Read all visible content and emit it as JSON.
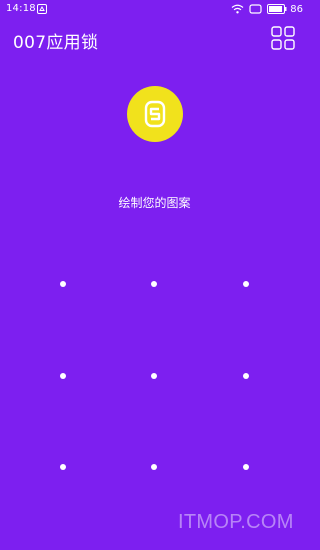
{
  "status_bar": {
    "time": "14:18",
    "battery_level": "86",
    "icons": [
      "notification-app-icon",
      "wifi-icon",
      "message-icon",
      "battery-icon"
    ]
  },
  "header": {
    "title": "007应用锁",
    "menu_icon": "grid-menu-icon"
  },
  "logo": {
    "icon": "lock-logo-icon",
    "accent_color": "#f1e21c"
  },
  "instruction": "绘制您的图案",
  "pattern": {
    "rows": 3,
    "cols": 3
  },
  "watermark": "ITMOP.COM",
  "colors": {
    "background": "#7d1ff0",
    "foreground": "#ffffff"
  }
}
